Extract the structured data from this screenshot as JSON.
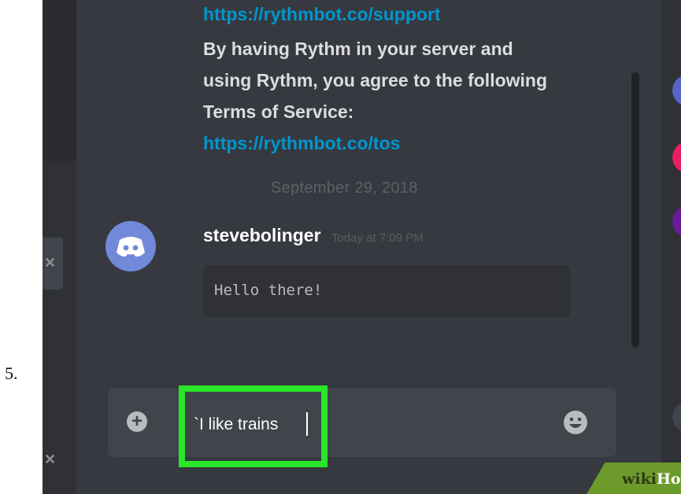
{
  "step_number": "5.",
  "messages": {
    "line_link_support": "https://rythmbot.co/support",
    "terms_line1": "By having Rythm in your server and",
    "terms_line2": "using Rythm, you agree to the following",
    "terms_line3": "Terms of Service:",
    "line_link_tos": "https://rythmbot.co/tos"
  },
  "date_divider": "September 29, 2018",
  "message": {
    "author": "stevebolinger",
    "timestamp": "Today at 7:09 PM",
    "code_text": "Hello there!"
  },
  "input": {
    "value": "`I like trains"
  },
  "watermark": {
    "wiki": "wiki",
    "how": "How"
  },
  "colors": {
    "background": "#36393f",
    "link": "#0096cf",
    "highlight": "#29e629",
    "avatar": "#7289da"
  }
}
